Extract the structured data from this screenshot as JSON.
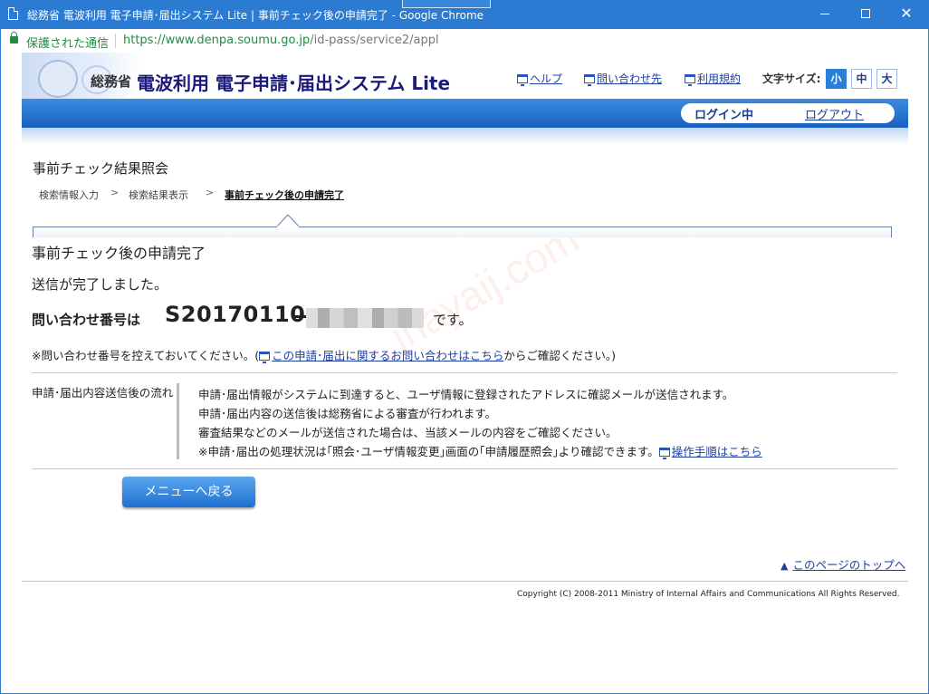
{
  "window": {
    "title": "総務省 電波利用 電子申請･届出システム Lite | 事前チェック後の申請完了 - Google Chrome"
  },
  "address_bar": {
    "secure_label": "保護された通信",
    "url_host": "https://www.denpa.soumu.go.jp",
    "url_path": "/id-pass/service2/appl"
  },
  "header": {
    "ministry": "総務省",
    "system_name": "電波利用 電子申請･届出システム Lite",
    "links": [
      "ヘルプ",
      "問い合わせ先",
      "利用規約"
    ],
    "font_size_label": "文字サイズ:",
    "font_sizes": [
      "小",
      "中",
      "大"
    ],
    "font_size_selected": "小",
    "login_status": "ログイン中",
    "logout": "ログアウト"
  },
  "page": {
    "title": "事前チェック結果照会",
    "breadcrumb": [
      "検索情報入力",
      "検索結果表示",
      "事前チェック後の申請完了"
    ],
    "breadcrumb_separator": ">",
    "heading": "事前チェック後の申請完了",
    "complete_message": "送信が完了しました。",
    "inquiry_label": "問い合わせ番号は",
    "inquiry_number": "S20170110",
    "inquiry_suffix": "です。",
    "note_prefix": "※問い合わせ番号を控えておいてください。(",
    "note_link": "この申請･届出に関するお問い合わせはこちら",
    "note_suffix": "からご確認ください。)",
    "flow_label": "申請･届出内容送信後の流れ",
    "flow_lines": [
      "申請･届出情報がシステムに到達すると、ユーザ情報に登録されたアドレスに確認メールが送信されます。",
      "申請･届出内容の送信後は総務省による審査が行われます。",
      "審査結果などのメールが送信された場合は、当該メールの内容をご確認ください。",
      "※申請･届出の処理状況は｢照会･ユーザ情報変更｣画面の｢申請履歴照会｣より確認できます。"
    ],
    "flow_link": "操作手順はこちら",
    "menu_button": "メニューへ戻る",
    "page_top": "このページのトップへ",
    "copyright": "Copyright (C) 2008-2011 Ministry of Internal Affairs and Communications All Rights Reserved."
  },
  "icons": {
    "window_link": "window-icon",
    "page_top": "up-triangle-icon"
  },
  "colors": {
    "titlebar": "#2b7bd2",
    "nav_bar": "#1a5fbf",
    "link": "#1f3f9f",
    "button": "#2a7fd9",
    "secure_green": "#1e8e3e"
  }
}
